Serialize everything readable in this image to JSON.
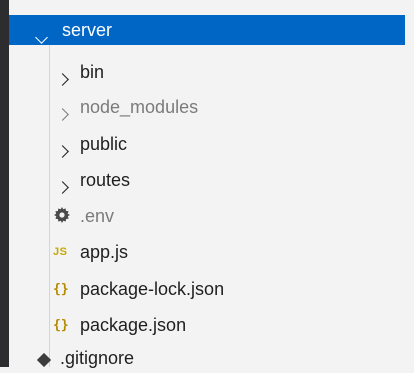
{
  "explorer": {
    "folder": {
      "label": "server",
      "expanded": true
    },
    "subfolders": [
      {
        "label": "bin",
        "dimmed": false
      },
      {
        "label": "node_modules",
        "dimmed": true
      },
      {
        "label": "public",
        "dimmed": false
      },
      {
        "label": "routes",
        "dimmed": false
      }
    ],
    "files": [
      {
        "label": ".env",
        "icon": "gear-icon",
        "dimmed": true
      },
      {
        "label": "app.js",
        "icon": "js-file-icon",
        "icon_text": "JS"
      },
      {
        "label": "package-lock.json",
        "icon": "json-file-icon",
        "icon_text": "{}"
      },
      {
        "label": "package.json",
        "icon": "json-file-icon",
        "icon_text": "{}"
      }
    ],
    "partial_item": {
      "label": ".gitignore",
      "icon": "git-icon"
    }
  },
  "colors": {
    "selection": "#0066c6",
    "background": "#f3f3f3",
    "js_icon": "#c8a700",
    "json_icon": "#b58a00"
  }
}
